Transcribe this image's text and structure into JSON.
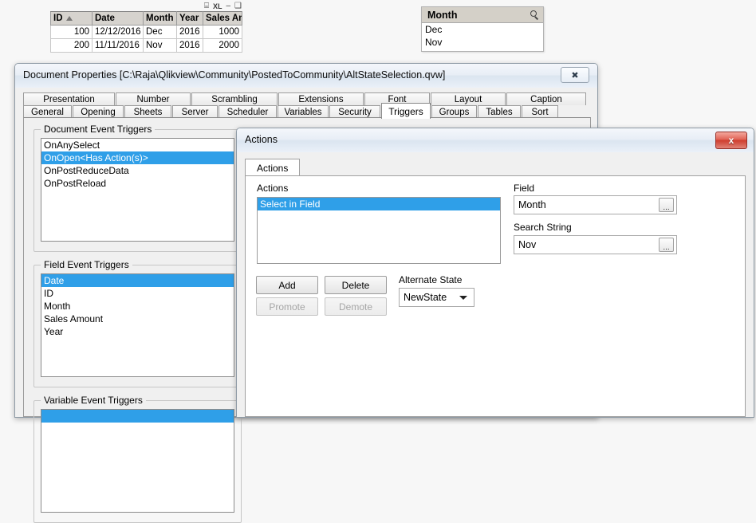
{
  "table_object": {
    "toolbar_icons": [
      "print-icon",
      "excel-export-icon",
      "minimize-icon",
      "maximize-icon"
    ],
    "toolbar_glyphs": {
      "print": "⌸",
      "excel": "XL",
      "minimize": "–",
      "maximize": "❑"
    },
    "columns": [
      "ID",
      "Date",
      "Month",
      "Year",
      "Sales Am..."
    ],
    "sorted_column": "ID",
    "rows": [
      {
        "id": "100",
        "date": "12/12/2016",
        "month": "Dec",
        "year": "2016",
        "sales": "1000"
      },
      {
        "id": "200",
        "date": "11/11/2016",
        "month": "Nov",
        "year": "2016",
        "sales": "2000"
      }
    ]
  },
  "month_listbox": {
    "caption": "Month",
    "search_icon": "magnifier-icon",
    "values": [
      "Dec",
      "Nov"
    ]
  },
  "document_properties": {
    "title": "Document Properties [C:\\Raja\\Qlikview\\Community\\PostedToCommunity\\AltStateSelection.qvw]",
    "close_label": "✖",
    "tabs_top": [
      "Presentation",
      "Number",
      "Scrambling",
      "Extensions",
      "Font",
      "Layout",
      "Caption"
    ],
    "tabs_bottom": [
      "General",
      "Opening",
      "Sheets",
      "Server",
      "Scheduler",
      "Variables",
      "Security",
      "Triggers",
      "Groups",
      "Tables",
      "Sort"
    ],
    "active_tab": "Triggers",
    "document_event_triggers": {
      "legend": "Document Event Triggers",
      "items": [
        "OnAnySelect",
        "OnOpen<Has Action(s)>",
        "OnPostReduceData",
        "OnPostReload"
      ],
      "selected": "OnOpen<Has Action(s)>"
    },
    "field_event_triggers": {
      "legend": "Field Event Triggers",
      "items": [
        "Date",
        "ID",
        "Month",
        "Sales Amount",
        "Year"
      ],
      "selected": "Date"
    },
    "variable_event_triggers": {
      "legend": "Variable Event Triggers"
    }
  },
  "actions_dialog": {
    "title": "Actions",
    "close_label": "x",
    "tab_label": "Actions",
    "actions_list": {
      "label": "Actions",
      "items": [
        "Select in Field"
      ],
      "selected": "Select in Field"
    },
    "field": {
      "label": "Field",
      "value": "Month",
      "browse_label": "..."
    },
    "search_string": {
      "label": "Search String",
      "value": "Nov",
      "browse_label": "..."
    },
    "buttons": {
      "add": "Add",
      "delete": "Delete",
      "promote": "Promote",
      "demote": "Demote"
    },
    "alternate_state": {
      "label": "Alternate State",
      "value": "NewState"
    }
  },
  "colors": {
    "selection_blue": "#2f9fe8",
    "caption_gray": "#d4d0c8",
    "page_background": "#f7f7f7"
  }
}
